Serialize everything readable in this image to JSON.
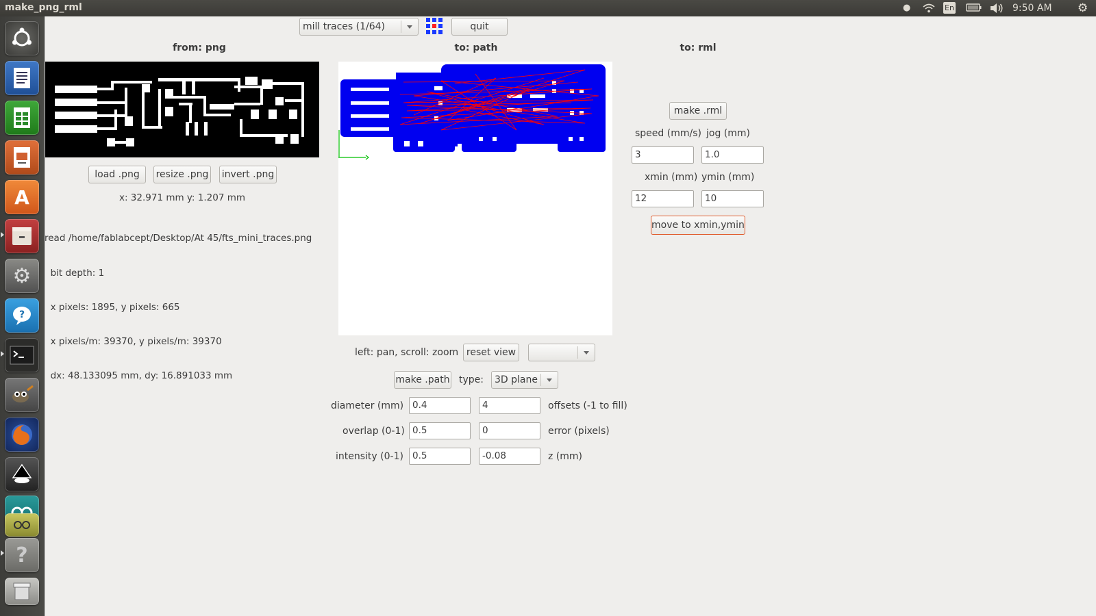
{
  "window": {
    "title": "make_png_rml"
  },
  "panel": {
    "keyboard": "En",
    "clock": "9:50 AM"
  },
  "toolbar": {
    "mode_selected": "mill traces (1/64)",
    "quit_label": "quit"
  },
  "png_panel": {
    "header": "from: png",
    "load_label": "load .png",
    "resize_label": "resize .png",
    "invert_label": "invert .png",
    "cursor_readout": "x: 32.971 mm  y: 1.207 mm",
    "info_lines": [
      "read /home/fablabcept/Desktop/At 45/fts_mini_traces.png",
      "  bit depth: 1",
      "  x pixels: 1895, y pixels: 665",
      "  x pixels/m: 39370, y pixels/m: 39370",
      "  dx: 48.133095 mm, dy: 16.891033 mm"
    ]
  },
  "path_panel": {
    "header": "to: path",
    "view_hint": "left: pan, scroll: zoom",
    "reset_view_label": "reset view",
    "view_select_value": "",
    "make_path_label": "make .path",
    "type_label": "type:",
    "type_selected": "3D plane",
    "diameter_label": "diameter (mm)",
    "diameter_value": "0.4",
    "offsets_value": "4",
    "offsets_label": "offsets (-1 to fill)",
    "overlap_label": "overlap (0-1)",
    "overlap_value": "0.5",
    "error_value": "0",
    "error_label": "error (pixels)",
    "intensity_label": "intensity (0-1)",
    "intensity_value": "0.5",
    "z_value": "-0.08",
    "z_label": "z (mm)"
  },
  "rml_panel": {
    "header": "to: rml",
    "make_rml_label": "make .rml",
    "speed_label": "speed (mm/s)",
    "jog_label": "jog (mm)",
    "speed_value": "3",
    "jog_value": "1.0",
    "xmin_label": "xmin (mm)",
    "ymin_label": "ymin (mm)",
    "xmin_value": "12",
    "ymin_value": "10",
    "move_label": "move to xmin,ymin"
  },
  "colors": {
    "path_fill": "#0000f0",
    "toolpath": "#ff0000",
    "origin_axis": "#00c000",
    "move_button_border": "#e05a2b"
  }
}
